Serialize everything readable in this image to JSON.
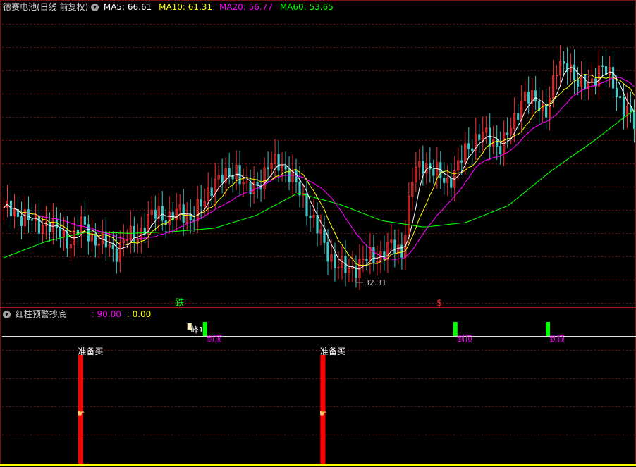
{
  "header": {
    "title": "德赛电池(日线 前复权)",
    "ma5_label": "MA5: 66.61",
    "ma10_label": "MA10: 61.31",
    "ma20_label": "MA20: 56.77",
    "ma60_label": "MA60: 53.65"
  },
  "indicator": {
    "title": "红柱预警抄底",
    "value1": ": 90.00",
    "value2": ": 0.00"
  },
  "colors": {
    "ma5": "#ffffff",
    "ma10": "#ffff00",
    "ma20": "#ff00ff",
    "ma60": "#00ff00",
    "up": "#ff3030",
    "down": "#40c8c8",
    "grid": "#7a1010",
    "signal_bar": "#ff0000",
    "top_signal": "#00ff00"
  },
  "icons": {
    "collapse": "circle-chevron-down-icon",
    "hand": "pointing-hand-icon"
  },
  "chart_data": {
    "type": "candlestick",
    "title": "德赛电池(日线 前复权)",
    "grid": true,
    "ylim": [
      29,
      78
    ],
    "low_marker": {
      "label": "32.31",
      "value": 32.31
    },
    "price_anchors": [
      44.3,
      42.8,
      43.2,
      40.6,
      42.1,
      39.5,
      38.6,
      41.2,
      39.2,
      38.1,
      36.6,
      38.9,
      39.2,
      42.1,
      43.4,
      42.4,
      43.5,
      42.6,
      44.8,
      49.3,
      49.1,
      51.2,
      46.9,
      48.6,
      51.4,
      52.2,
      49.5,
      46.1,
      41.9,
      37.6,
      34.5,
      33.3,
      34.4,
      35.5,
      36.1,
      37.4,
      36.8,
      49.8,
      52.3,
      50.3,
      48.6,
      51.1,
      54.8,
      57.1,
      55.8,
      55.2,
      58.1,
      64.3,
      62.2,
      61.3,
      67.7,
      69.8,
      64.8,
      66.2,
      68.2,
      66.7,
      61.2,
      59.1
    ],
    "series": [
      {
        "name": "MA5",
        "value": 66.61
      },
      {
        "name": "MA10",
        "value": 61.31
      },
      {
        "name": "MA20",
        "value": 56.77
      },
      {
        "name": "MA60",
        "value": 53.65
      }
    ],
    "ma60_anchors": [
      35.6,
      38.4,
      40.1,
      39.8,
      40.1,
      40.7,
      42.9,
      46.8,
      44.8,
      42.0,
      40.9,
      41.7,
      44.6,
      50.5,
      55.6,
      61.2
    ],
    "markers": [
      {
        "label": "跌",
        "color": "#00ff00",
        "position": 0.28
      },
      {
        "label": "$",
        "color": "#ff2020",
        "position": 0.69
      }
    ],
    "indicator_bars": [
      {
        "label": "准备买",
        "position": 0.124,
        "value": 90.0
      },
      {
        "label": "准备买",
        "position": 0.506,
        "value": 90.0
      }
    ],
    "top_signals": [
      {
        "label": "到顶",
        "position": 0.32,
        "extra": "峰1"
      },
      {
        "label": "到顶",
        "position": 0.715
      },
      {
        "label": "到顶",
        "position": 0.861
      }
    ]
  }
}
